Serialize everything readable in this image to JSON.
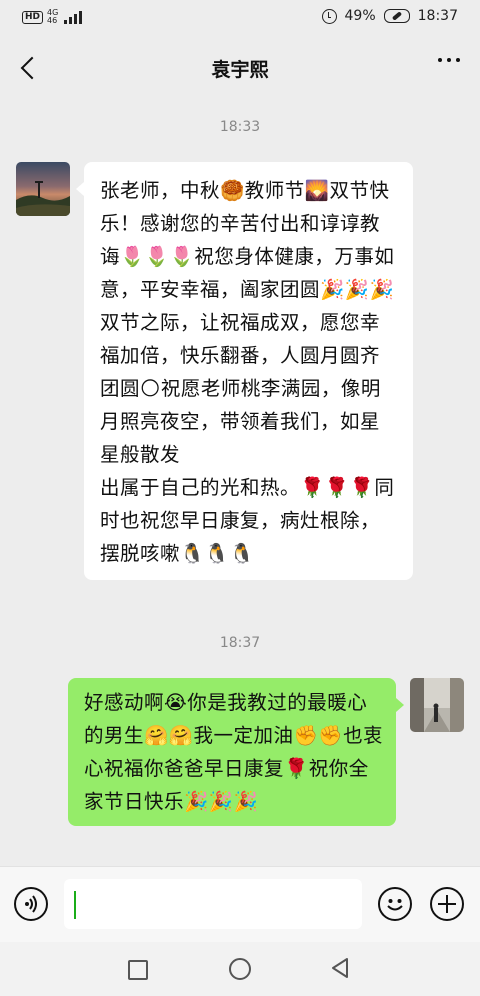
{
  "status_bar": {
    "hd": "HD",
    "net_top": "4G",
    "net_bottom": "46",
    "battery_pct": "49%",
    "time": "18:37"
  },
  "header": {
    "title": "袁宇熙"
  },
  "messages": [
    {
      "timestamp": "18:33",
      "side": "incoming",
      "text": "张老师，中秋🥮教师节🌄双节快乐！感谢您的辛苦付出和谆谆教诲🌷🌷🌷祝您身体健康，万事如意，平安幸福，阖家团圆🎉🎉🎉双节之际，让祝福成双，愿您幸福加倍，快乐翻番，人圆月圆齐团圆🌕祝愿老师桃李满园，像明月照亮夜空，带领着我们，如星星般散发\n出属于自己的光和热。🌹🌹🌹同时也祝您早日康复，病灶根除，摆脱咳嗽🐧🐧🐧"
    },
    {
      "timestamp": "18:37",
      "side": "outgoing",
      "text": "好感动啊😭你是我教过的最暖心的男生🤗🤗我一定加油✊✊也衷心祝福你爸爸早日康复🌹祝你全家节日快乐🎉🎉🎉"
    }
  ],
  "colors": {
    "background": "#ededed",
    "outgoing_bubble": "#95ec69",
    "incoming_bubble": "#ffffff",
    "caret": "#1aad19"
  },
  "icons": {
    "back": "chevron-left-icon",
    "more": "more-horizontal-icon",
    "voice": "voice-icon",
    "emoji": "emoji-icon",
    "plus": "plus-icon"
  }
}
